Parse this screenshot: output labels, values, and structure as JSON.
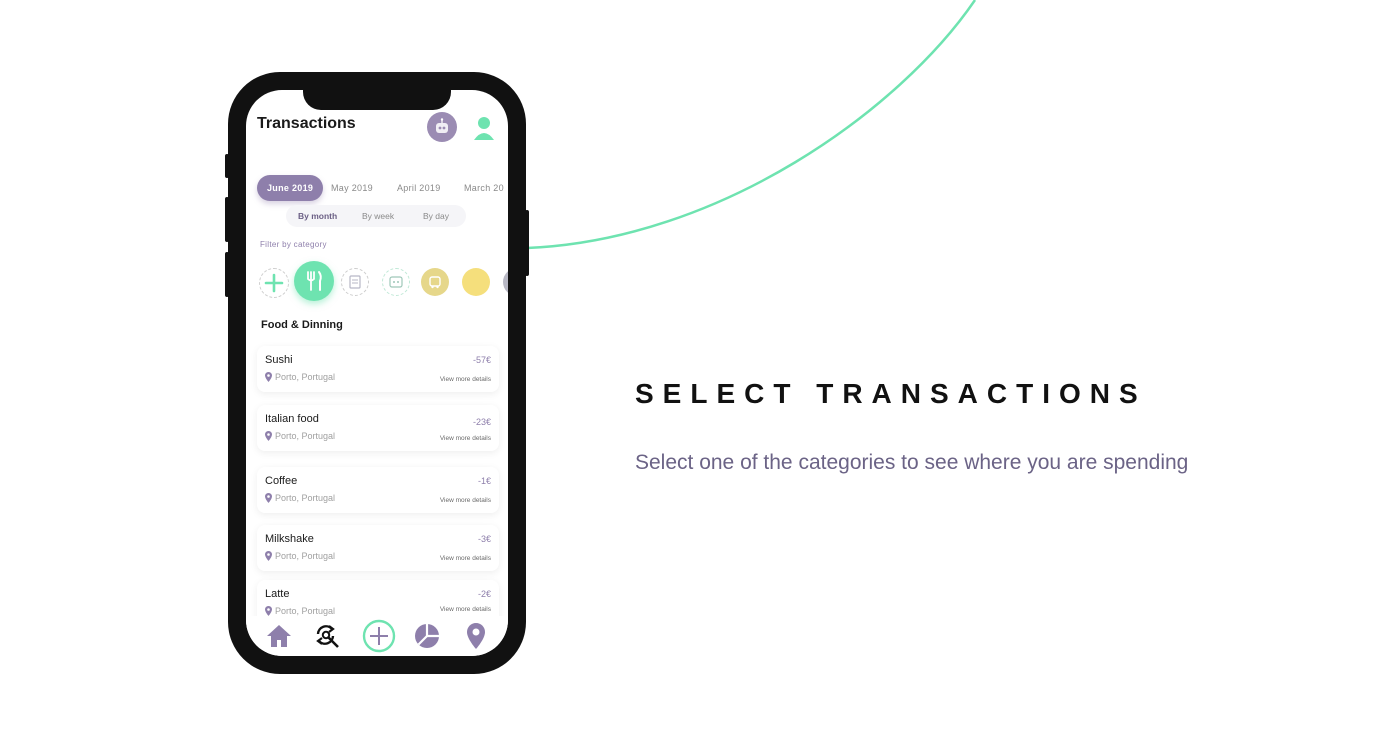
{
  "app": {
    "title": "Transactions",
    "months": [
      "June 2019",
      "May 2019",
      "April 2019",
      "March 20"
    ],
    "active_month_index": 0,
    "periods": [
      "By month",
      "By week",
      "By day"
    ],
    "active_period_index": 0,
    "filter_label": "Filter by category",
    "categories": [
      "add-category",
      "food-dining",
      "bills",
      "entertainment",
      "transport",
      "other",
      "more"
    ],
    "active_category": "food-dining",
    "section_title": "Food & Dinning",
    "transactions": [
      {
        "name": "Sushi",
        "amount": "-57€",
        "location": "Porto, Portugal",
        "details": "View more details"
      },
      {
        "name": "Italian food",
        "amount": "-23€",
        "location": "Porto, Portugal",
        "details": "View more details"
      },
      {
        "name": "Coffee",
        "amount": "-1€",
        "location": "Porto, Portugal",
        "details": "View more details"
      },
      {
        "name": "Milkshake",
        "amount": "-3€",
        "location": "Porto, Portugal",
        "details": "View more details"
      },
      {
        "name": "Latte",
        "amount": "-2€",
        "location": "Porto, Portugal",
        "details": "View more details"
      }
    ],
    "nav": [
      "home-icon",
      "search-refresh-icon",
      "add-icon",
      "chart-icon",
      "location-icon"
    ]
  },
  "promo": {
    "heading": "SELECT TRANSACTIONS",
    "subtitle": "Select one of the categories to see where you are spending"
  },
  "colors": {
    "accent_purple": "#8e7fab",
    "accent_green": "#6ee3b0",
    "accent_yellow": "#f5df7c"
  }
}
